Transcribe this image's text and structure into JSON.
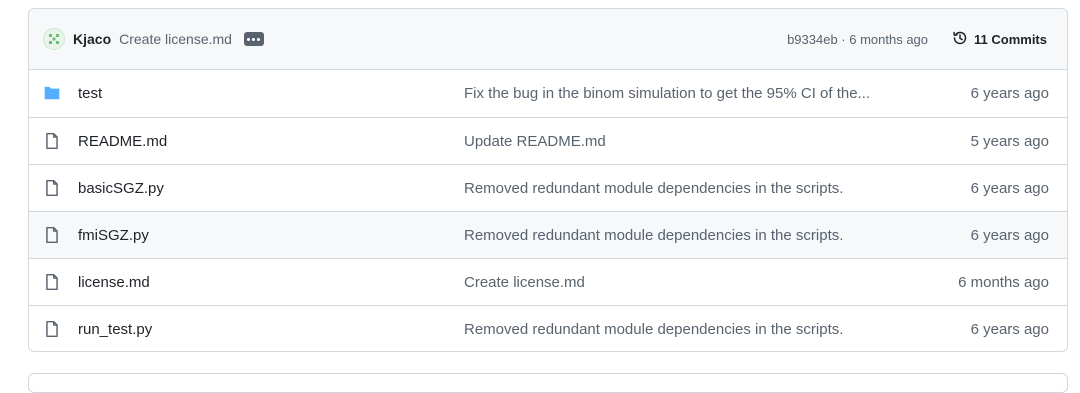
{
  "header": {
    "author": "Kjaco",
    "commit_message": "Create license.md",
    "sha_and_age": "b9334eb · 6 months ago",
    "commits_label": "11 Commits"
  },
  "files": [
    {
      "type": "folder",
      "name": "test",
      "message": "Fix the bug in the binom simulation to get the 95% CI of the...",
      "age": "6 years ago"
    },
    {
      "type": "file",
      "name": "README.md",
      "message": "Update README.md",
      "age": "5 years ago"
    },
    {
      "type": "file",
      "name": "basicSGZ.py",
      "message": "Removed redundant module dependencies in the scripts.",
      "age": "6 years ago"
    },
    {
      "type": "file",
      "name": "fmiSGZ.py",
      "message": "Removed redundant module dependencies in the scripts.",
      "age": "6 years ago"
    },
    {
      "type": "file",
      "name": "license.md",
      "message": "Create license.md",
      "age": "6 months ago"
    },
    {
      "type": "file",
      "name": "run_test.py",
      "message": "Removed redundant module dependencies in the scripts.",
      "age": "6 years ago"
    }
  ],
  "colors": {
    "folder": "#54aeff",
    "border": "#d1d9e0",
    "header_bg": "#f6f8fa",
    "muted_text": "#59636e"
  }
}
